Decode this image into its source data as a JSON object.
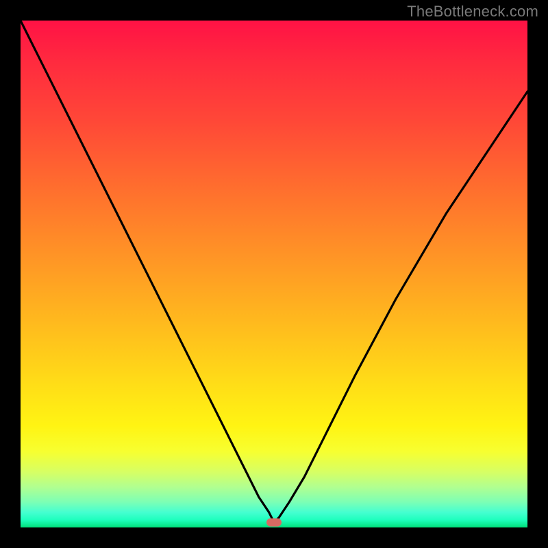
{
  "watermark": "TheBottleneck.com",
  "chart_data": {
    "type": "line",
    "title": "",
    "xlabel": "",
    "ylabel": "",
    "xlim": [
      0,
      100
    ],
    "ylim": [
      0,
      100
    ],
    "grid": false,
    "legend": false,
    "background_gradient": {
      "top_color": "#ff1245",
      "bottom_color": "#00e07b",
      "description": "vertical rainbow gradient red→orange→yellow→green"
    },
    "series": [
      {
        "name": "bottleneck-curve",
        "color": "#000000",
        "x": [
          0,
          6,
          12,
          18,
          24,
          30,
          34,
          38,
          42,
          45,
          47,
          49,
          50,
          51,
          53,
          56,
          60,
          66,
          74,
          84,
          96,
          100
        ],
        "y": [
          100,
          88,
          76,
          64,
          52,
          40,
          32,
          24,
          16,
          10,
          6,
          3,
          1,
          2,
          5,
          10,
          18,
          30,
          45,
          62,
          80,
          86
        ]
      }
    ],
    "marker": {
      "name": "optimal-point",
      "x": 50,
      "y": 1,
      "color": "#d86a63",
      "shape": "pill"
    },
    "border": {
      "color": "#000000",
      "thickness_px": 30
    }
  }
}
